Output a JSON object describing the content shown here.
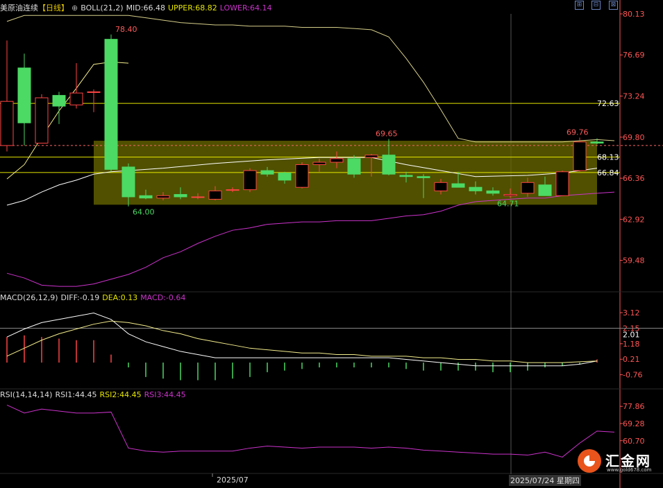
{
  "header": {
    "symbol": "美原油连续",
    "period": "【日线】",
    "indicator": "BOLL(21,2)",
    "mid": "MID:66.48",
    "upper": "UPPER:68.82",
    "lower": "LOWER:64.14"
  },
  "toolbar": {
    "icon1": "⊞",
    "icon2": "⊟",
    "icon3": "⊠"
  },
  "macd_header": {
    "name": "MACD(26,12,9)",
    "diff": "DIFF:-0.19",
    "dea": "DEA:0.13",
    "macd": "MACD:-0.64"
  },
  "rsi_header": {
    "name": "RSI(14,14,14)",
    "rsi1": "RSI1:44.45",
    "rsi2": "RSI2:44.45",
    "rsi3": "RSI3:44.45"
  },
  "x_axis": {
    "month_label": "2025/07",
    "crosshair_label": "2025/07/24 星期四"
  },
  "logo": {
    "name": "汇金网",
    "url": "www.gold678.com"
  },
  "colors": {
    "up": "#ff4444",
    "down": "#4cd964",
    "mid": "#ffffff",
    "upper": "#f5ee8c",
    "lower": "#cc33cc",
    "level": "#e6e600",
    "zone": "#6b6b00",
    "axis": "#ff5555"
  },
  "chart_data": [
    {
      "type": "candlestick",
      "name": "price",
      "y_ticks": [
        80.13,
        76.69,
        73.24,
        69.8,
        66.36,
        62.92,
        59.48
      ],
      "ylim": [
        56.9,
        80.13
      ],
      "price_labels": [
        "72.63",
        "68.13",
        "66.84"
      ],
      "levels": [
        72.63,
        68.13,
        66.84
      ],
      "current_price": 69.1,
      "zone": [
        64.14,
        69.5
      ],
      "annotations": [
        {
          "text": "78.40",
          "index": 6,
          "value": 78.4,
          "kind": "high"
        },
        {
          "text": "64.00",
          "index": 7,
          "value": 64.0,
          "kind": "low"
        },
        {
          "text": "69.65",
          "index": 21,
          "value": 69.65,
          "kind": "high"
        },
        {
          "text": "64.71",
          "index": 28,
          "value": 64.71,
          "kind": "low"
        },
        {
          "text": "69.76",
          "index": 32,
          "value": 69.76,
          "kind": "high"
        }
      ],
      "candles": [
        {
          "o": 69.1,
          "h": 77.9,
          "l": 68.6,
          "c": 72.8
        },
        {
          "o": 75.6,
          "h": 76.8,
          "l": 69.1,
          "c": 71.0
        },
        {
          "o": 69.3,
          "h": 73.4,
          "l": 69.3,
          "c": 73.1
        },
        {
          "o": 73.3,
          "h": 73.6,
          "l": 70.9,
          "c": 72.4
        },
        {
          "o": 72.5,
          "h": 76.0,
          "l": 72.2,
          "c": 73.5
        },
        {
          "o": 73.6,
          "h": 73.8,
          "l": 71.9,
          "c": 73.6
        },
        {
          "o": 78.0,
          "h": 78.4,
          "l": 66.9,
          "c": 67.1
        },
        {
          "o": 67.3,
          "h": 67.6,
          "l": 64.0,
          "c": 64.8
        },
        {
          "o": 64.9,
          "h": 65.4,
          "l": 64.6,
          "c": 64.7
        },
        {
          "o": 64.7,
          "h": 65.2,
          "l": 64.5,
          "c": 64.9
        },
        {
          "o": 65.0,
          "h": 65.6,
          "l": 64.6,
          "c": 64.8
        },
        {
          "o": 64.8,
          "h": 65.1,
          "l": 64.6,
          "c": 64.8
        },
        {
          "o": 64.6,
          "h": 65.7,
          "l": 64.5,
          "c": 65.3
        },
        {
          "o": 65.4,
          "h": 65.6,
          "l": 65.2,
          "c": 65.4
        },
        {
          "o": 65.4,
          "h": 67.2,
          "l": 65.2,
          "c": 67.0
        },
        {
          "o": 67.0,
          "h": 67.3,
          "l": 66.5,
          "c": 66.7
        },
        {
          "o": 66.8,
          "h": 66.9,
          "l": 65.9,
          "c": 66.2
        },
        {
          "o": 65.6,
          "h": 67.7,
          "l": 65.5,
          "c": 67.5
        },
        {
          "o": 67.5,
          "h": 68.0,
          "l": 66.9,
          "c": 67.7
        },
        {
          "o": 67.7,
          "h": 68.6,
          "l": 67.2,
          "c": 68.0
        },
        {
          "o": 68.0,
          "h": 68.3,
          "l": 66.4,
          "c": 66.7
        },
        {
          "o": 68.1,
          "h": 68.4,
          "l": 66.5,
          "c": 68.3
        },
        {
          "o": 68.3,
          "h": 69.65,
          "l": 66.6,
          "c": 66.7
        },
        {
          "o": 66.6,
          "h": 66.9,
          "l": 66.0,
          "c": 66.5
        },
        {
          "o": 66.5,
          "h": 66.7,
          "l": 64.7,
          "c": 66.4
        },
        {
          "o": 65.3,
          "h": 66.3,
          "l": 65.0,
          "c": 66.0
        },
        {
          "o": 65.9,
          "h": 66.9,
          "l": 65.6,
          "c": 65.6
        },
        {
          "o": 65.6,
          "h": 66.1,
          "l": 65.0,
          "c": 65.3
        },
        {
          "o": 65.3,
          "h": 65.6,
          "l": 64.9,
          "c": 65.1
        },
        {
          "o": 64.9,
          "h": 65.5,
          "l": 64.71,
          "c": 65.0
        },
        {
          "o": 65.1,
          "h": 66.4,
          "l": 64.8,
          "c": 66.0
        },
        {
          "o": 65.8,
          "h": 66.5,
          "l": 64.9,
          "c": 64.9
        },
        {
          "o": 64.9,
          "h": 67.0,
          "l": 64.9,
          "c": 66.9
        },
        {
          "o": 67.0,
          "h": 69.76,
          "l": 66.9,
          "c": 69.4
        },
        {
          "o": 69.4,
          "h": 69.7,
          "l": 69.2,
          "c": 69.3
        }
      ],
      "boll_mid": [
        67.0,
        68.2,
        69.4,
        70.8,
        72.4,
        74.1,
        75.8,
        75.7,
        75.7,
        75.6,
        75.5,
        75.4,
        75.4,
        75.3,
        75.2,
        75.2,
        75.2,
        75.1,
        75.1,
        75.1,
        75.0,
        75.0,
        74.6,
        73.6,
        72.5,
        70.9,
        68.6,
        68.4,
        68.4,
        68.4,
        68.3,
        68.3,
        68.3,
        68.4,
        69.3,
        69.7
      ],
      "boll_mid_note": "",
      "boll_upper": [],
      "boll_lower": []
    },
    {
      "type": "line+bar",
      "name": "macd",
      "y_ticks": [
        3.12,
        2.15,
        1.18,
        0.21,
        -0.76
      ],
      "ylim": [
        -1.6,
        3.6
      ],
      "price_label": "2.01",
      "level": 2.15
    },
    {
      "type": "line",
      "name": "rsi",
      "y_ticks": [
        77.86,
        69.28,
        60.7
      ],
      "ylim": [
        44.0,
        80.0
      ],
      "rsi": [
        78.5,
        74.5,
        76.5,
        75.5,
        74.5,
        74.5,
        75.0,
        57.0,
        55.5,
        55.0,
        55.5,
        55.5,
        55.5,
        55.5,
        57.0,
        58.0,
        57.5,
        57.0,
        57.5,
        57.5,
        57.5,
        57.0,
        57.5,
        57.0,
        56.0,
        55.5,
        55.0,
        54.5,
        54.0,
        54.0,
        53.5,
        55.0,
        52.5,
        59.5,
        65.5,
        65.0
      ]
    }
  ]
}
